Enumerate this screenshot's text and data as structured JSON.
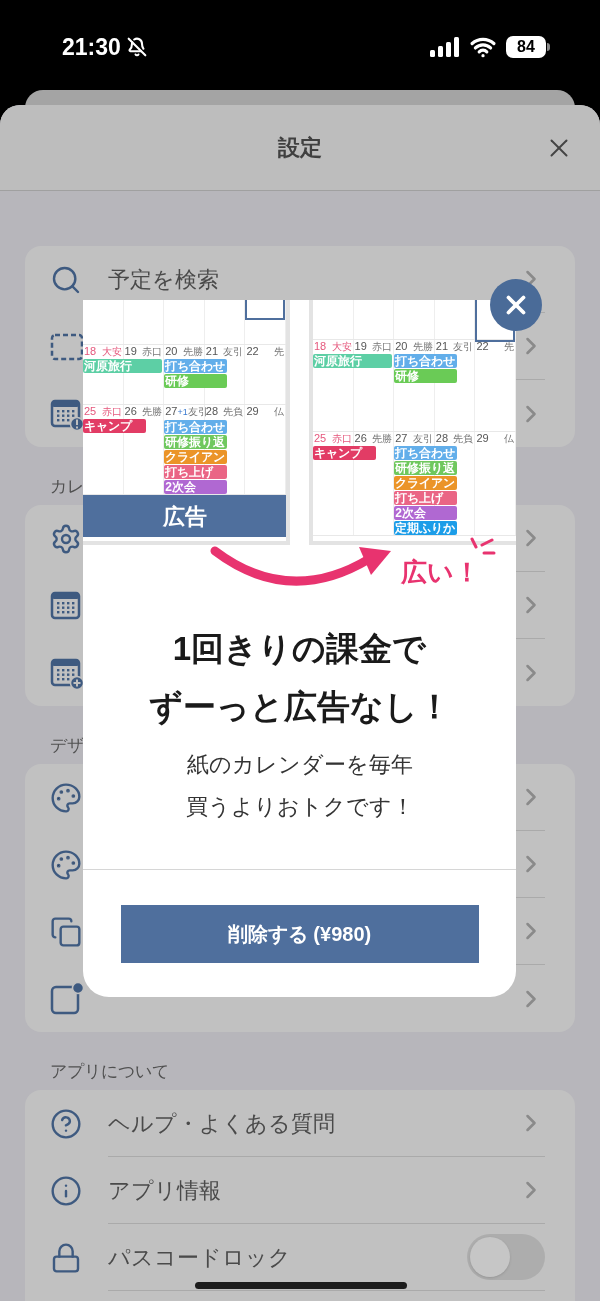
{
  "status_bar": {
    "time": "21:30",
    "battery": "84"
  },
  "sheet": {
    "title": "設定"
  },
  "sections": [
    {
      "rows": [
        {
          "kind": "link",
          "label": "予定を検索"
        },
        {
          "kind": "link"
        },
        {
          "kind": "link"
        }
      ]
    },
    {
      "header": "カレ",
      "rows": [
        {
          "kind": "link"
        },
        {
          "kind": "link"
        },
        {
          "kind": "link"
        }
      ]
    },
    {
      "header": "デザ",
      "rows": [
        {
          "kind": "link"
        },
        {
          "kind": "link"
        },
        {
          "kind": "link"
        },
        {
          "kind": "link"
        }
      ]
    },
    {
      "header": "アプリについて",
      "rows": [
        {
          "kind": "link",
          "label": "ヘルプ・よくある質問"
        },
        {
          "kind": "link",
          "label": "アプリ情報"
        },
        {
          "kind": "toggle",
          "label": "パスコードロック",
          "on": false
        }
      ]
    }
  ],
  "promo": {
    "calendars": [
      {
        "kind": "small",
        "banner": "広告",
        "weeks": [
          {
            "days": [
              {
                "date": "18",
                "rokuyo": "大安",
                "sunday": true,
                "events": [
                  {
                    "label": "河原旅行",
                    "color": "#5dcfa5",
                    "multi_day": true
                  }
                ]
              },
              {
                "date": "19",
                "rokuyo": "赤口",
                "sunday": false
              },
              {
                "date": "20",
                "rokuyo": "先勝",
                "sunday": false,
                "events": [
                  {
                    "label": "打ち合わせ",
                    "color": "#62aeea",
                    "multi_day": false
                  },
                  {
                    "label": "研修",
                    "color": "#6acb56",
                    "multi_day": false
                  }
                ]
              },
              {
                "date": "21",
                "rokuyo": "友引",
                "sunday": false
              },
              {
                "date": "22",
                "rokuyo": "先",
                "sunday": false
              }
            ]
          },
          {
            "days": [
              {
                "date": "25",
                "rokuyo": "赤口",
                "sunday": true,
                "events": [
                  {
                    "label": "キャンプ",
                    "color": "#e23c65",
                    "multi_day": false
                  }
                ]
              },
              {
                "date": "26",
                "rokuyo": "先勝",
                "sunday": false
              },
              {
                "date": "27",
                "more": "+1",
                "rokuyo": "友引",
                "sunday": false,
                "events": [
                  {
                    "label": "打ち合わせ",
                    "color": "#62aeea",
                    "multi_day": false
                  },
                  {
                    "label": "研修振り返",
                    "color": "#6fc85e",
                    "multi_day": false
                  },
                  {
                    "label": "クライアン",
                    "color": "#eb9428",
                    "multi_day": false
                  },
                  {
                    "label": "打ち上げ",
                    "color": "#ea6585",
                    "multi_day": false
                  },
                  {
                    "label": "2次会",
                    "color": "#b068d2",
                    "multi_day": false
                  }
                ]
              },
              {
                "date": "28",
                "rokuyo": "先負",
                "sunday": false
              },
              {
                "date": "29",
                "rokuyo": "仏",
                "sunday": false
              }
            ]
          }
        ]
      },
      {
        "kind": "large",
        "weeks": [
          {
            "days": [
              {
                "date": "18",
                "rokuyo": "大安",
                "sunday": true,
                "events": [
                  {
                    "label": "河原旅行",
                    "color": "#5dcfa5",
                    "multi_day": true
                  }
                ]
              },
              {
                "date": "19",
                "rokuyo": "赤口",
                "sunday": false
              },
              {
                "date": "20",
                "rokuyo": "先勝",
                "sunday": false,
                "events": [
                  {
                    "label": "打ち合わせ",
                    "color": "#62aeea",
                    "multi_day": false
                  },
                  {
                    "label": "研修",
                    "color": "#6acb56",
                    "multi_day": false
                  }
                ]
              },
              {
                "date": "21",
                "rokuyo": "友引",
                "sunday": false
              },
              {
                "date": "22",
                "rokuyo": "先",
                "sunday": false
              }
            ]
          },
          {
            "days": [
              {
                "date": "25",
                "rokuyo": "赤口",
                "sunday": true,
                "events": [
                  {
                    "label": "キャンプ",
                    "color": "#e23c65",
                    "multi_day": false
                  }
                ]
              },
              {
                "date": "26",
                "rokuyo": "先勝",
                "sunday": false
              },
              {
                "date": "27",
                "rokuyo": "友引",
                "sunday": false,
                "events": [
                  {
                    "label": "打ち合わせ",
                    "color": "#62aeea",
                    "multi_day": false
                  },
                  {
                    "label": "研修振り返",
                    "color": "#6fc85e",
                    "multi_day": false
                  },
                  {
                    "label": "クライアン",
                    "color": "#eb9428",
                    "multi_day": false
                  },
                  {
                    "label": "打ち上げ",
                    "color": "#ea6585",
                    "multi_day": false
                  },
                  {
                    "label": "2次会",
                    "color": "#b068d2",
                    "multi_day": false
                  },
                  {
                    "label": "定期ふりか",
                    "color": "#1c9de8",
                    "multi_day": false
                  }
                ]
              },
              {
                "date": "28",
                "rokuyo": "先負",
                "sunday": false
              },
              {
                "date": "29",
                "rokuyo": "仏",
                "sunday": false
              }
            ]
          }
        ]
      }
    ],
    "callout": "広い！",
    "headline": [
      "1回きりの課金で",
      "ずーっと広告なし！"
    ],
    "subtitle": [
      "紙のカレンダーを毎年",
      "買うよりおトクです！"
    ],
    "button": "削除する (¥980)"
  }
}
